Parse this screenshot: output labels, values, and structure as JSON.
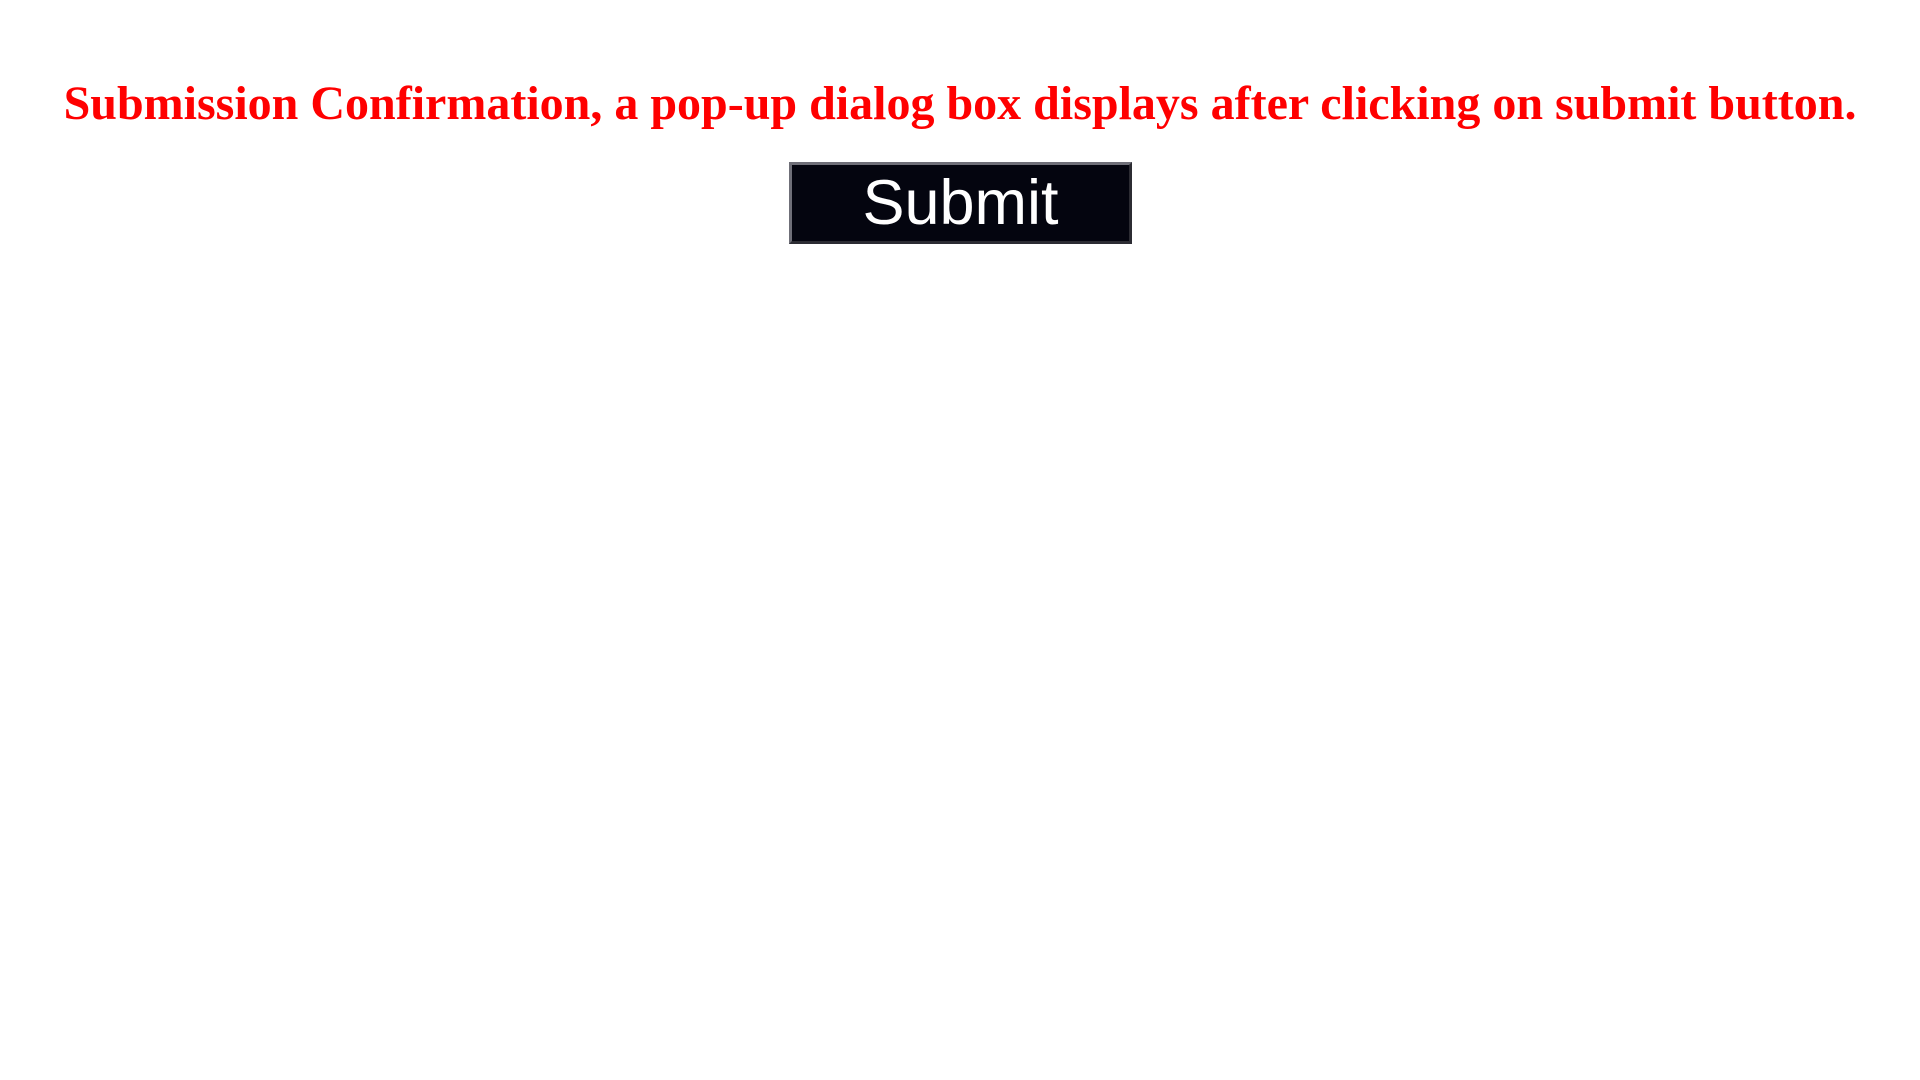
{
  "heading": {
    "text": "Submission Confirmation, a pop-up dialog box displays after clicking on submit button.",
    "color": "#ff0000"
  },
  "submit_button": {
    "label": "Submit",
    "background": "#04050f",
    "text_color": "#ffffff"
  }
}
